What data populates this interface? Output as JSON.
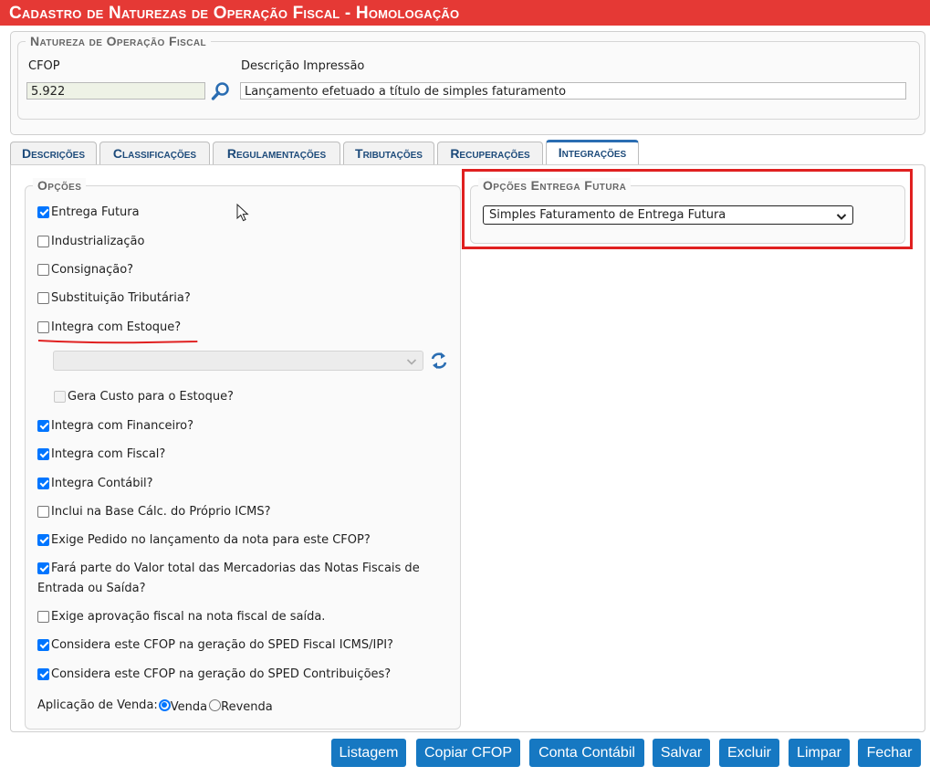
{
  "window": {
    "title": "Cadastro de Naturezas de Operação Fiscal  - Homologação"
  },
  "natureza": {
    "legend": "Natureza de Operação Fiscal",
    "cfop_label": "CFOP",
    "cfop_value": "5.922",
    "descricao_label": "Descrição Impressão",
    "descricao_value": "Lançamento efetuado a título de simples faturamento"
  },
  "tabs": [
    {
      "label": "Descrições",
      "active": false
    },
    {
      "label": "Classificações",
      "active": false
    },
    {
      "label": "Regulamentações",
      "active": false
    },
    {
      "label": "Tributações",
      "active": false
    },
    {
      "label": "Recuperações",
      "active": false
    },
    {
      "label": "Integrações",
      "active": true
    }
  ],
  "opcoes": {
    "legend": "Opções",
    "items": [
      {
        "label": "Entrega Futura",
        "checked": true
      },
      {
        "label": "Industrialização",
        "checked": false
      },
      {
        "label": "Consignação?",
        "checked": false
      },
      {
        "label": "Substituição Tributária?",
        "checked": false
      },
      {
        "label": "Integra com Estoque?",
        "checked": false
      },
      {
        "label": "Gera Custo para o Estoque?",
        "checked": false
      },
      {
        "label": "Integra com Financeiro?",
        "checked": true
      },
      {
        "label": "Integra com Fiscal?",
        "checked": true
      },
      {
        "label": "Integra Contábil?",
        "checked": true
      },
      {
        "label": "Inclui na Base Cálc. do Próprio ICMS?",
        "checked": false
      },
      {
        "label": "Exige Pedido no lançamento da nota para este CFOP?",
        "checked": true
      },
      {
        "label": "Fará parte do Valor total das Mercadorias das Notas Fiscais de",
        "label2": "Entrada ou Saída?",
        "checked": true
      },
      {
        "label": "Exige aprovação fiscal na nota fiscal de saída.",
        "checked": false
      },
      {
        "label": "Considera este CFOP na geração do SPED Fiscal ICMS/IPI?",
        "checked": true
      },
      {
        "label": "Considera este CFOP na geração do SPED Contribuições?",
        "checked": true
      }
    ],
    "aplicacao_label": "Aplicação de Venda:",
    "aplicacao_options": [
      {
        "label": "Venda",
        "selected": true
      },
      {
        "label": "Revenda",
        "selected": false
      }
    ]
  },
  "entrega_futura": {
    "legend": "Opções Entrega Futura",
    "selected": "Simples Faturamento de Entrega Futura"
  },
  "buttons": [
    "Listagem",
    "Copiar CFOP",
    "Conta Contábil",
    "Salvar",
    "Excluir",
    "Limpar",
    "Fechar"
  ],
  "colors": {
    "title_bg": "#e53935",
    "accent": "#1678c2",
    "highlight": "#e02020",
    "check": "#0075ff"
  }
}
